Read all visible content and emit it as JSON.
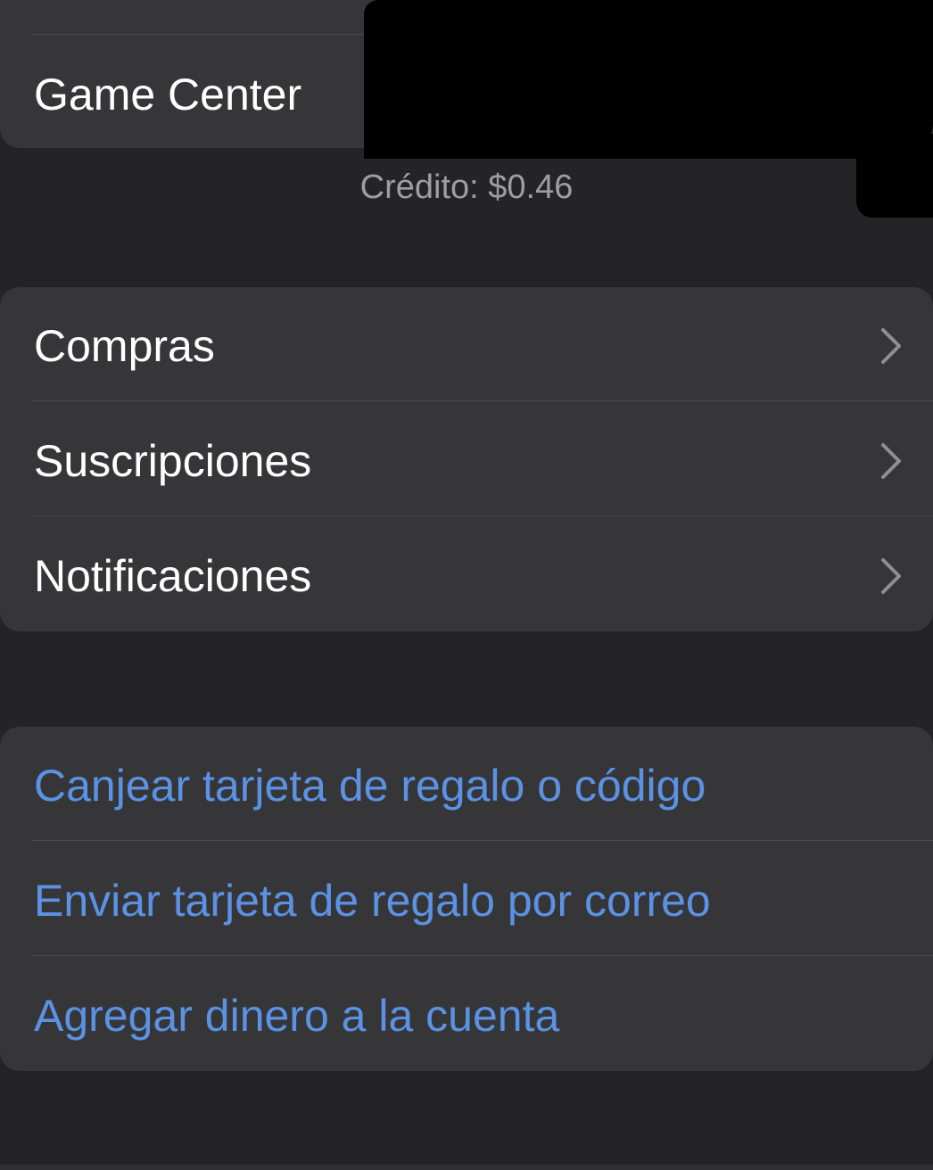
{
  "profile": {
    "game_center_label": "Game Center",
    "credit_text": "Crédito: $0.46"
  },
  "account_menu": {
    "items": [
      {
        "label": "Compras",
        "icon": "chevron-right-icon"
      },
      {
        "label": "Suscripciones",
        "icon": "chevron-right-icon"
      },
      {
        "label": "Notificaciones",
        "icon": "chevron-right-icon"
      }
    ]
  },
  "gift_actions": {
    "items": [
      {
        "label": "Canjear tarjeta de regalo o código"
      },
      {
        "label": "Enviar tarjeta de regalo por correo"
      },
      {
        "label": "Agregar dinero a la cuenta"
      }
    ]
  },
  "colors": {
    "background": "#242426",
    "card": "#363638",
    "link_blue": "#5b92e3",
    "secondary_text": "#9d9da2",
    "chevron": "#8e8e93"
  }
}
